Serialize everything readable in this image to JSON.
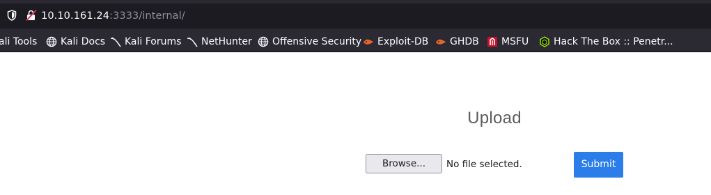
{
  "urlbar": {
    "url_host": "10.10.161.24",
    "url_rest": ":3333/internal/"
  },
  "bookmarks": [
    {
      "label": "ali Tools",
      "icon": "kali-tools-icon"
    },
    {
      "label": "Kali Docs",
      "icon": "globe-icon"
    },
    {
      "label": "Kali Forums",
      "icon": "kali-dragon-icon"
    },
    {
      "label": "NetHunter",
      "icon": "kali-dragon-icon"
    },
    {
      "label": "Offensive Security",
      "icon": "globe-icon"
    },
    {
      "label": "Exploit-DB",
      "icon": "exploit-db-icon"
    },
    {
      "label": "GHDB",
      "icon": "exploit-db-icon"
    },
    {
      "label": "MSFU",
      "icon": "msfu-icon"
    },
    {
      "label": "Hack The Box :: Penetr...",
      "icon": "hackthebox-icon"
    }
  ],
  "page": {
    "title": "Upload",
    "browse_label": "Browse...",
    "file_status": "No file selected.",
    "submit_label": "Submit"
  },
  "colors": {
    "toolbar_bg": "#2b2a33",
    "urlbar_bg": "#1c1b22",
    "submit_bg": "#2b7de9"
  }
}
